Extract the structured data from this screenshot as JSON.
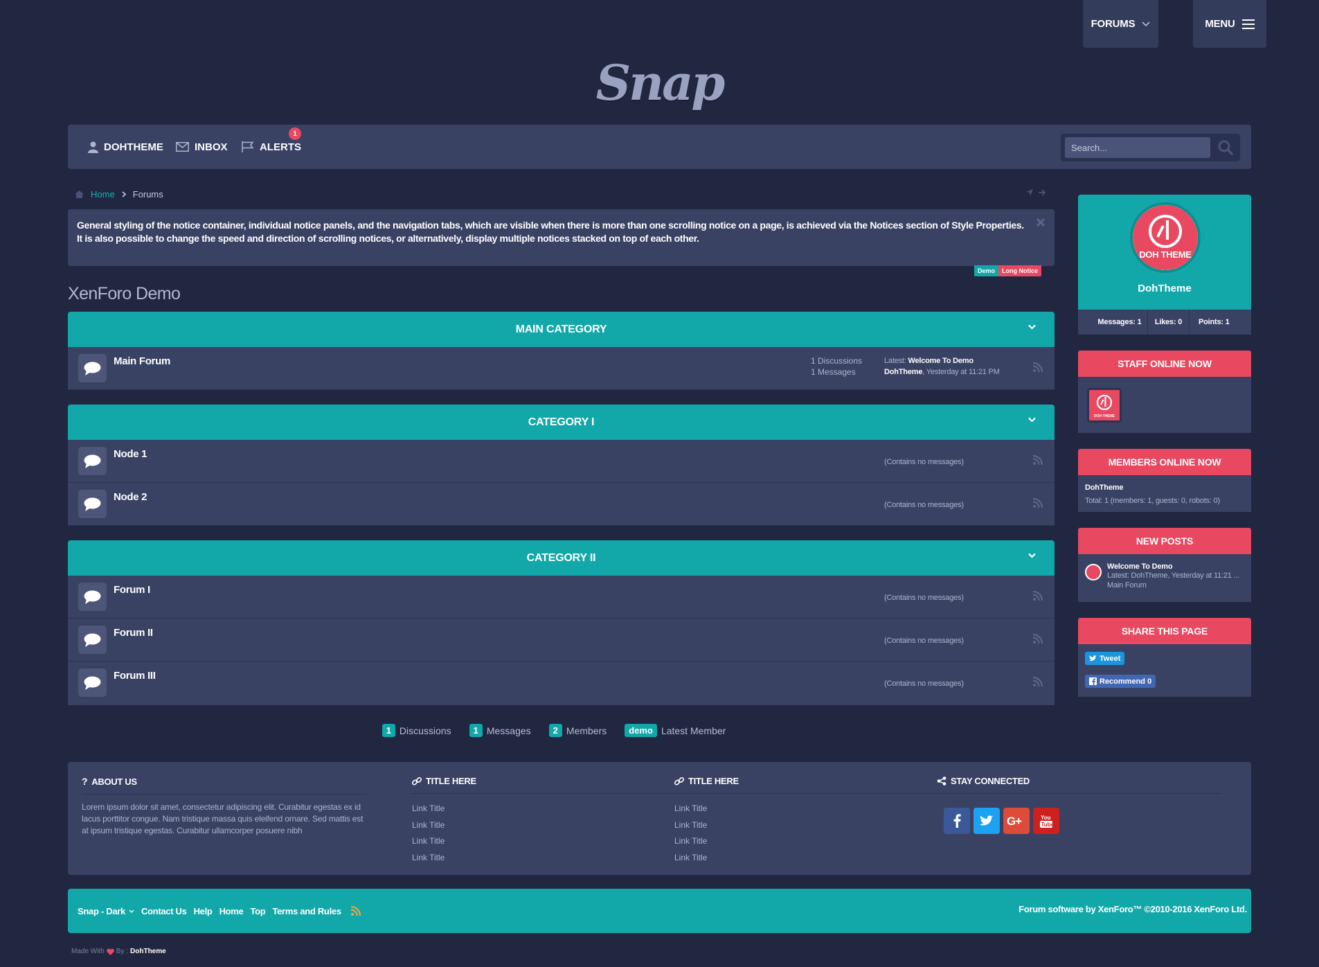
{
  "top_buttons": {
    "forums_label": "FORUMS",
    "menu_label": "MENU"
  },
  "logo_text": "Snap",
  "nav": {
    "user_label": "DOHTHEME",
    "inbox_label": "INBOX",
    "alerts_label": "ALERTS",
    "alerts_count": "1",
    "search_placeholder": "Search..."
  },
  "breadcrumb": {
    "home": "Home",
    "current": "Forums"
  },
  "notice": {
    "text": "General styling of the notice container, individual notice panels, and the navigation tabs, which are visible when there is more than one scrolling notice on a page, is achieved via the Notices section of Style Properties. It is also possible to change the speed and direction of scrolling notices, or alternatively, display multiple notices stacked on top of each other.",
    "tabs": [
      "Demo",
      "Long Notice"
    ]
  },
  "section_title": "XenForo Demo",
  "categories": [
    {
      "title": "MAIN CATEGORY",
      "nodes": [
        {
          "title": "Main Forum",
          "discussions": "1 Discussions",
          "messages": "1 Messages",
          "latest_prefix": "Latest:",
          "latest_title": "Welcome To Demo",
          "latest_user": "DohTheme",
          "latest_time": ", Yesterday at 11:21 PM"
        }
      ]
    },
    {
      "title": "CATEGORY I",
      "nodes": [
        {
          "title": "Node 1",
          "empty": "(Contains no messages)"
        },
        {
          "title": "Node 2",
          "empty": "(Contains no messages)"
        }
      ]
    },
    {
      "title": "CATEGORY II",
      "nodes": [
        {
          "title": "Forum I",
          "empty": "(Contains no messages)"
        },
        {
          "title": "Forum II",
          "empty": "(Contains no messages)"
        },
        {
          "title": "Forum III",
          "empty": "(Contains no messages)"
        }
      ]
    }
  ],
  "stats": [
    {
      "value": "1",
      "label": "Discussions"
    },
    {
      "value": "1",
      "label": "Messages"
    },
    {
      "value": "2",
      "label": "Members"
    },
    {
      "value": "demo",
      "label": "Latest Member"
    }
  ],
  "sidebar": {
    "profile": {
      "avatar_text": "DOH THEME",
      "name": "DohTheme",
      "messages": "Messages: 1",
      "likes": "Likes: 0",
      "points": "Points: 1"
    },
    "staff_online": {
      "title": "STAFF ONLINE NOW",
      "avatar_text": "DOH THEME"
    },
    "members_online": {
      "title": "MEMBERS ONLINE NOW",
      "member": "DohTheme",
      "total": "Total: 1 (members: 1, guests: 0, robots: 0)"
    },
    "new_posts": {
      "title": "NEW POSTS",
      "post_title": "Welcome To Demo",
      "post_meta": "Latest: DohTheme, Yesterday at 11:21 ...",
      "post_forum": "Main Forum"
    },
    "share": {
      "title": "SHARE THIS PAGE",
      "tweet": "Tweet",
      "recommend": "Recommend 0"
    }
  },
  "footer": {
    "about": {
      "title": "ABOUT US",
      "text": "Lorem ipsum dolor sit amet, consectetur adipiscing elit. Curabitur egestas ex id lacus porttitor congue. Nam tristique massa quis eleifend ornare. Sed mattis est at ipsum tristique egestas. Curabitur ullamcorper posuere nibh"
    },
    "col2": {
      "title": "TITLE HERE",
      "links": [
        "Link Title",
        "Link Title",
        "Link Title",
        "Link Title"
      ]
    },
    "col3": {
      "title": "TITLE HERE",
      "links": [
        "Link Title",
        "Link Title",
        "Link Title",
        "Link Title"
      ]
    },
    "connect": {
      "title": "STAY CONNECTED"
    }
  },
  "bottom_bar": {
    "style": "Snap - Dark",
    "links": [
      "Contact Us",
      "Help",
      "Home",
      "Top",
      "Terms and Rules"
    ],
    "copyright": "Forum software by XenForo™ ©2010-2016 XenForo Ltd."
  },
  "made_with": {
    "prefix": "Made With",
    "by": "By :",
    "author": "DohTheme"
  },
  "colors": {
    "accent": "#12a8a9",
    "highlight": "#e84860",
    "panel": "#3a4264",
    "background": "#212740"
  }
}
